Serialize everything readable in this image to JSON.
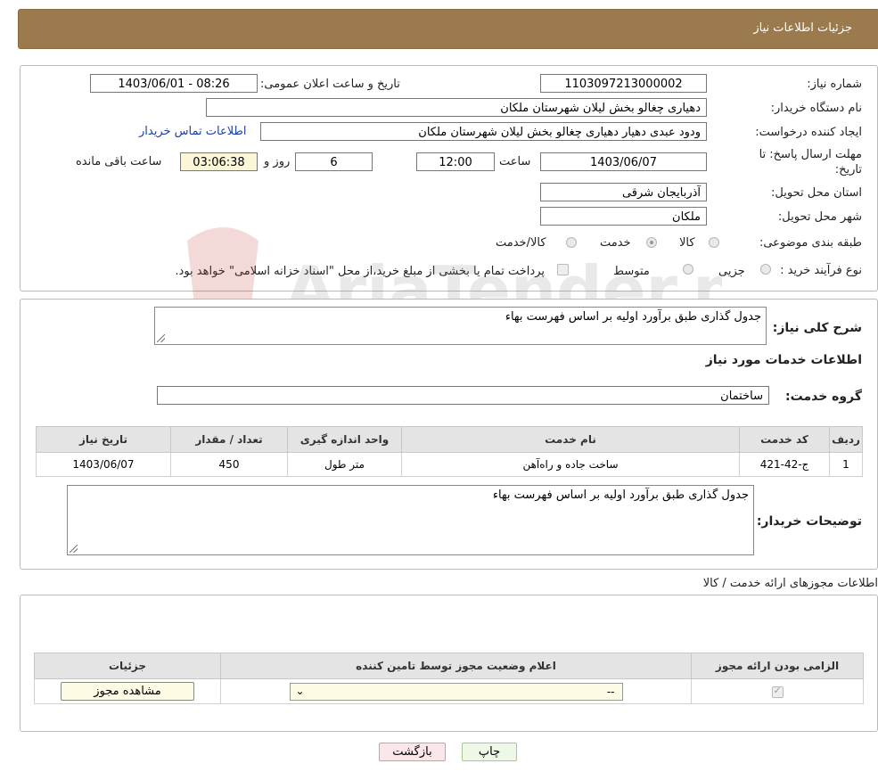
{
  "header": {
    "title": "جزئیات اطلاعات نیاز"
  },
  "form": {
    "need_number_label": "شماره نیاز:",
    "need_number": "1103097213000002",
    "announce_label": "تاریخ و ساعت اعلان عمومی:",
    "announce_value": "1403/06/01 - 08:26",
    "buyer_org_label": "نام دستگاه خریدار:",
    "buyer_org": "دهیاری چغالو بخش لیلان شهرستان ملکان",
    "creator_label": "ایجاد کننده درخواست:",
    "creator": "ودود عبدی دهیار دهیاری چغالو بخش لیلان شهرستان ملکان",
    "contact_link": "اطلاعات تماس خریدار",
    "deadline_label_1": "مهلت ارسال پاسخ: تا",
    "deadline_label_2": "تاریخ:",
    "deadline_date": "1403/06/07",
    "time_label": "ساعت",
    "deadline_time": "12:00",
    "days_value": "6",
    "days_label": "روز و",
    "remaining_time": "03:06:38",
    "remaining_label": "ساعت باقی مانده",
    "province_label": "استان محل تحویل:",
    "province": "آذربایجان شرقی",
    "city_label": "شهر محل تحویل:",
    "city": "ملکان",
    "category_label": "طبقه بندی موضوعی:",
    "category_options": [
      {
        "label": "کالا",
        "selected": false
      },
      {
        "label": "خدمت",
        "selected": true
      },
      {
        "label": "کالا/خدمت",
        "selected": false
      }
    ],
    "process_label": "نوع فرآیند خرید :",
    "process_options": [
      {
        "label": "جزیی",
        "selected": false
      },
      {
        "label": "متوسط",
        "selected": false
      }
    ],
    "payment_note": "پرداخت تمام یا بخشی از مبلغ خرید،از محل \"اسناد خزانه اسلامی\" خواهد بود."
  },
  "details": {
    "summary_label": "شرح کلی نیاز:",
    "summary": "جدول گذاری طبق برآورد اولیه بر اساس فهرست بهاء",
    "services_title": "اطلاعات خدمات مورد نیاز",
    "service_group_label": "گروه خدمت:",
    "service_group": "ساختمان",
    "table": {
      "headers": [
        "ردیف",
        "کد خدمت",
        "نام خدمت",
        "واحد اندازه گیری",
        "تعداد / مقدار",
        "تاریخ نیاز"
      ],
      "rows": [
        [
          "1",
          "ج-42-421",
          "ساخت جاده و راه‌آهن",
          "متر طول",
          "450",
          "1403/06/07"
        ]
      ]
    },
    "buyer_notes_label": "توضیحات خریدار:",
    "buyer_notes": "جدول گذاری طبق برآورد اولیه بر اساس فهرست بهاء"
  },
  "permits": {
    "title": "اطلاعات مجوزهای ارائه خدمت / کالا",
    "headers": [
      "الزامی بودن ارائه مجوز",
      "اعلام وضعیت مجوز توسط تامین کننده",
      "جزئیات"
    ],
    "row": {
      "required_checked": true,
      "status_value": "--",
      "view_button": "مشاهده مجوز"
    }
  },
  "actions": {
    "print": "چاپ",
    "back": "بازگشت"
  },
  "watermark": {
    "text": "AriaTender.neT"
  }
}
